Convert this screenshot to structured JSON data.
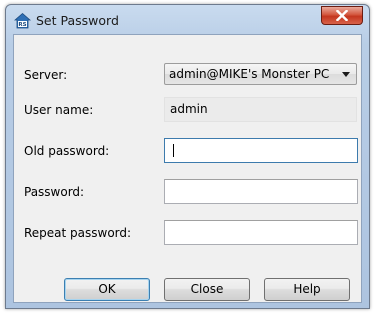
{
  "window": {
    "title": "Set Password",
    "icon": "rs-server-icon",
    "close_icon": "close-icon"
  },
  "form": {
    "server": {
      "label": "Server:",
      "value": "admin@MIKE's Monster PC"
    },
    "username": {
      "label": "User name:",
      "value": "admin"
    },
    "old_password": {
      "label": "Old password:",
      "value": ""
    },
    "password": {
      "label": "Password:",
      "value": ""
    },
    "repeat_password": {
      "label": "Repeat password:",
      "value": ""
    }
  },
  "buttons": {
    "ok": "OK",
    "close": "Close",
    "help": "Help"
  },
  "colors": {
    "title_frame": "#b8cde6",
    "close_button": "#c4361f",
    "dialog_bg": "#f0f0f0",
    "focus_border": "#3d7bad"
  }
}
